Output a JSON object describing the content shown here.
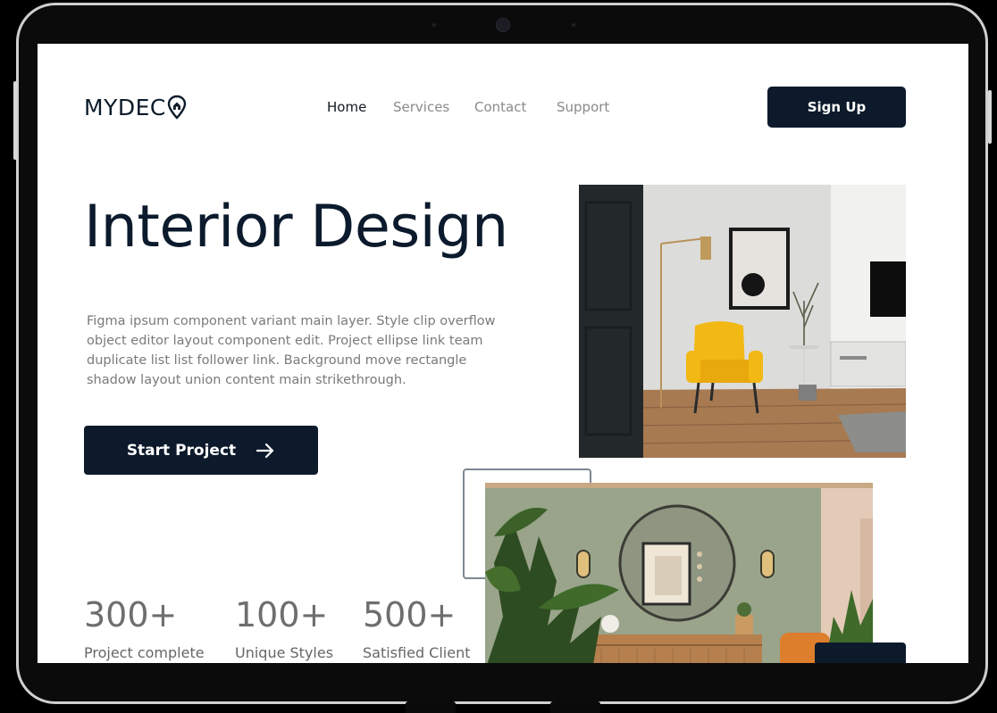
{
  "brand": {
    "logo_text": "MYDEC"
  },
  "nav": {
    "items": [
      {
        "label": "Home",
        "active": true
      },
      {
        "label": "Services",
        "active": false
      },
      {
        "label": "Contact",
        "active": false
      },
      {
        "label": "Support",
        "active": false
      }
    ]
  },
  "header": {
    "signup_label": "Sign Up"
  },
  "hero": {
    "title": "Interior Design",
    "description": "Figma ipsum component variant main layer. Style clip overflow object editor layout component edit. Project ellipse link team duplicate list list follower link. Background move rectangle shadow layout union content main strikethrough.",
    "cta_label": "Start Project"
  },
  "stats": [
    {
      "value": "300+",
      "label": "Project complete"
    },
    {
      "value": "100+",
      "label": "Unique Styles"
    },
    {
      "value": "500+",
      "label": "Satisfied Client"
    }
  ],
  "colors": {
    "primary": "#0c1a2b",
    "muted_text": "#7a7a7a",
    "chair_yellow": "#f2b814"
  },
  "icons": {
    "logo_mark": "location-pin-house-icon",
    "cta_arrow": "arrow-right-icon"
  }
}
